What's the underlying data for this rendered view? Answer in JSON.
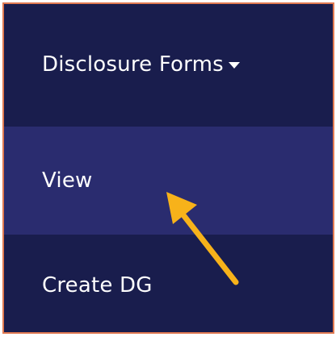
{
  "menu": {
    "header": {
      "label": "Disclosure Forms",
      "icon": "caret-down-icon"
    },
    "items": [
      {
        "label": "View"
      },
      {
        "label": "Create DG"
      }
    ]
  },
  "colors": {
    "menu_background": "#191d4d",
    "highlight_background": "#2a2c6f",
    "text": "#ffffff",
    "annotation_arrow": "#f7b21a",
    "frame_border": "#e07a52"
  }
}
